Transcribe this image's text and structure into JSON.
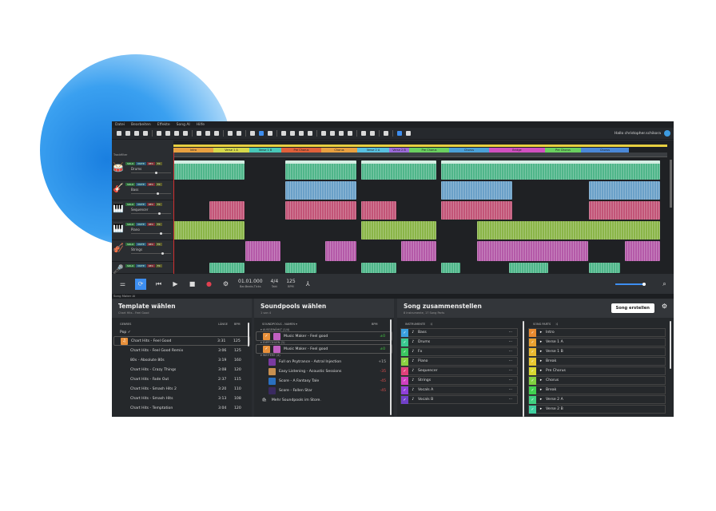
{
  "menu": [
    "Datei",
    "Bearbeiten",
    "Effekte",
    "Song AI",
    "Hilfe"
  ],
  "user": "Hallo christopher.schikora",
  "track_header": "Trackfilter",
  "track_buttons": [
    "SOLO",
    "MUTE",
    "REC",
    "FX"
  ],
  "tracks": [
    {
      "name": "Drums",
      "icon": "drums-icon",
      "glyph": "🥁",
      "color": "#4fb68a"
    },
    {
      "name": "Bass",
      "icon": "bass-guitar-icon",
      "glyph": "🎸",
      "color": "#6aa0c8"
    },
    {
      "name": "Sequencer",
      "icon": "keyboard-icon",
      "glyph": "🎹",
      "color": "#c25477"
    },
    {
      "name": "Piano",
      "icon": "piano-icon",
      "glyph": "🎹",
      "color": "#8ab548"
    },
    {
      "name": "Strings",
      "icon": "guitar-icon",
      "glyph": "🎻",
      "color": "#b45aa8"
    },
    {
      "name": "Vocals",
      "icon": "vocals-icon",
      "glyph": "🎤",
      "color": "#4fb68a"
    }
  ],
  "song_parts": [
    {
      "label": "Intro",
      "color": "#e8a040"
    },
    {
      "label": "Verse 1 A",
      "color": "#d6d84a"
    },
    {
      "label": "Verse 1 B",
      "color": "#48c8b8"
    },
    {
      "label": "Pre Chorus",
      "color": "#e0603a"
    },
    {
      "label": "Chorus",
      "color": "#e8a040"
    },
    {
      "label": "Verse 2 A",
      "color": "#58c0e0"
    },
    {
      "label": "Verse 2 B",
      "color": "#9a6ad8"
    },
    {
      "label": "Pre Chorus",
      "color": "#6ad060"
    },
    {
      "label": "Chorus",
      "color": "#4aa0d8"
    },
    {
      "label": "Bridge",
      "color": "#d050c0"
    },
    {
      "label": "Pre Chorus",
      "color": "#6ad060"
    },
    {
      "label": "Chorus",
      "color": "#4a88d8"
    }
  ],
  "transport": {
    "position": "01.01.000",
    "position_label": "Bar.Beats.Ticks",
    "meter": "4/4",
    "meter_label": "Takt",
    "tempo": "125",
    "tempo_label": "BPM"
  },
  "song_maker_label": "Song Maker AI",
  "template": {
    "title": "Template wählen",
    "subtitle": "Chart Hits - Feel Good",
    "col_genres": "GENRES",
    "col_length": "LÄNGE",
    "col_bpm": "BPM",
    "genre": "Pop ✓",
    "items": [
      {
        "name": "Chart Hits - Feel Good",
        "length": "3:31",
        "bpm": "125"
      },
      {
        "name": "Chart Hits - Feel Good Remix",
        "length": "3:06",
        "bpm": "125"
      },
      {
        "name": "80s - Absolute 80s",
        "length": "3:19",
        "bpm": "160"
      },
      {
        "name": "Chart Hits - Crazy Things",
        "length": "3:08",
        "bpm": "120"
      },
      {
        "name": "Chart Hits - Fade Out",
        "length": "2:37",
        "bpm": "115"
      },
      {
        "name": "Chart Hits - Smash Hits 2",
        "length": "3:20",
        "bpm": "110"
      },
      {
        "name": "Chart Hits - Smash Hits",
        "length": "3:13",
        "bpm": "108"
      },
      {
        "name": "Chart Hits - Temptation",
        "length": "3:04",
        "bpm": "120"
      }
    ]
  },
  "soundpools": {
    "title": "Soundpools wählen",
    "subtitle": "1 von 4",
    "col_name": "SOUNDPOOLS - NAMEN ▾",
    "col_bpm": "BPM",
    "group_selected": "▾ AUSGEWÄHLT (1/4)",
    "group_recommended": "▾ EMPFOHLEN (1)",
    "group_more": "▾ WEITERE (4)",
    "selected": {
      "name": "Music Maker - Feel good",
      "bpm": "±0"
    },
    "recommended": {
      "name": "Music Maker - Feel good",
      "bpm": "±0"
    },
    "more": [
      {
        "name": "Full on Psytrance - Astral Injection",
        "bpm": "+15",
        "color": "#7a3aa0"
      },
      {
        "name": "Easy Listening - Acoustic Sessions",
        "bpm": "-35",
        "color": "#c89050"
      },
      {
        "name": "Score - A Fantasy Tale",
        "bpm": "-45",
        "color": "#2a70c0"
      },
      {
        "name": "Score - Fallen Star",
        "bpm": "-45",
        "color": "#3a2a60"
      }
    ],
    "store": "Mehr Soundpools im Store."
  },
  "song": {
    "title": "Song zusammenstellen",
    "subtitle": "8 Instrumente, 17 Song Parts",
    "create": "Song erstellen",
    "col_instruments": "INSTRUMENTE",
    "col_parts": "SONG PARTS",
    "instruments": [
      {
        "name": "Bass",
        "color": "#3aa0e0"
      },
      {
        "name": "Drums",
        "color": "#3ac890"
      },
      {
        "name": "Fx",
        "color": "#3ac860"
      },
      {
        "name": "Piano",
        "color": "#8ad040"
      },
      {
        "name": "Sequencer",
        "color": "#e0407a"
      },
      {
        "name": "Strings",
        "color": "#d040c0"
      },
      {
        "name": "Vocals A",
        "color": "#9040d8"
      },
      {
        "name": "Vocals B",
        "color": "#7040c8"
      }
    ],
    "parts": [
      {
        "name": "Intro",
        "color": "#e88a30"
      },
      {
        "name": "Verse 1 A",
        "color": "#e8a030"
      },
      {
        "name": "Verse 1 B",
        "color": "#e8b830"
      },
      {
        "name": "Break",
        "color": "#e8c830"
      },
      {
        "name": "Pre Chorus",
        "color": "#d8d830"
      },
      {
        "name": "Chorus",
        "color": "#80d040"
      },
      {
        "name": "Break",
        "color": "#40d050"
      },
      {
        "name": "Verse 2 A",
        "color": "#40d080"
      },
      {
        "name": "Verse 2 B",
        "color": "#40d0a0"
      }
    ]
  }
}
